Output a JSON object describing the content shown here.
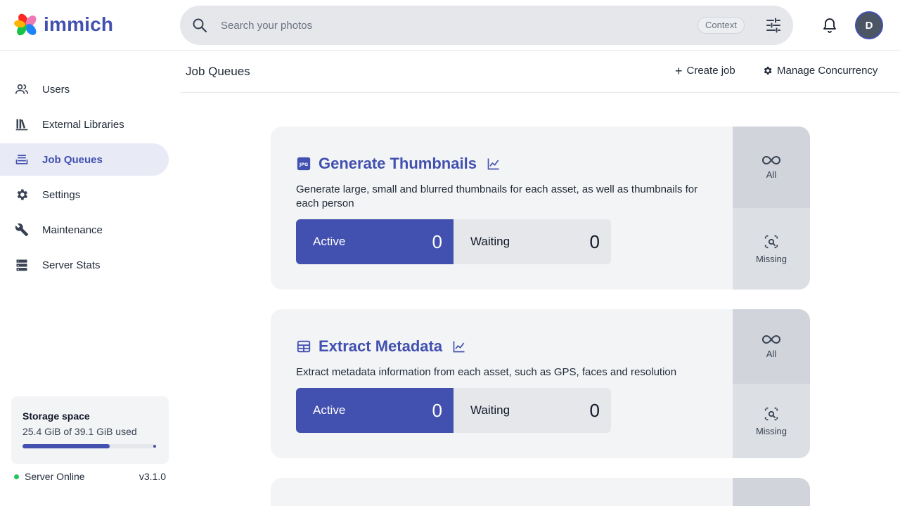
{
  "app": {
    "name": "immich"
  },
  "search": {
    "placeholder": "Search your photos",
    "context_label": "Context"
  },
  "user": {
    "initial": "D"
  },
  "sidebar": {
    "items": [
      {
        "label": "Users",
        "icon": "users-icon"
      },
      {
        "label": "External Libraries",
        "icon": "library-icon"
      },
      {
        "label": "Job Queues",
        "icon": "queue-icon",
        "active": true
      },
      {
        "label": "Settings",
        "icon": "gear-icon"
      },
      {
        "label": "Maintenance",
        "icon": "wrench-icon"
      },
      {
        "label": "Server Stats",
        "icon": "server-icon"
      }
    ],
    "storage": {
      "title": "Storage space",
      "used": "25.4 GiB of 39.1 GiB used",
      "fraction": 0.65
    },
    "server": {
      "status": "Server Online",
      "version": "v3.1.0"
    }
  },
  "page": {
    "title": "Job Queues",
    "create_job": "Create job",
    "manage_concurrency": "Manage Concurrency"
  },
  "jobs": [
    {
      "title": "Generate Thumbnails",
      "description": "Generate large, small and blurred thumbnails for each asset, as well as thumbnails for each person",
      "active_label": "Active",
      "active_count": "0",
      "waiting_label": "Waiting",
      "waiting_count": "0",
      "all_label": "All",
      "missing_label": "Missing"
    },
    {
      "title": "Extract Metadata",
      "description": "Extract metadata information from each asset, such as GPS, faces and resolution",
      "active_label": "Active",
      "active_count": "0",
      "waiting_label": "Waiting",
      "waiting_count": "0",
      "all_label": "All",
      "missing_label": "Missing"
    }
  ],
  "colors": {
    "accent": "#4250af",
    "online": "#22c55e"
  }
}
